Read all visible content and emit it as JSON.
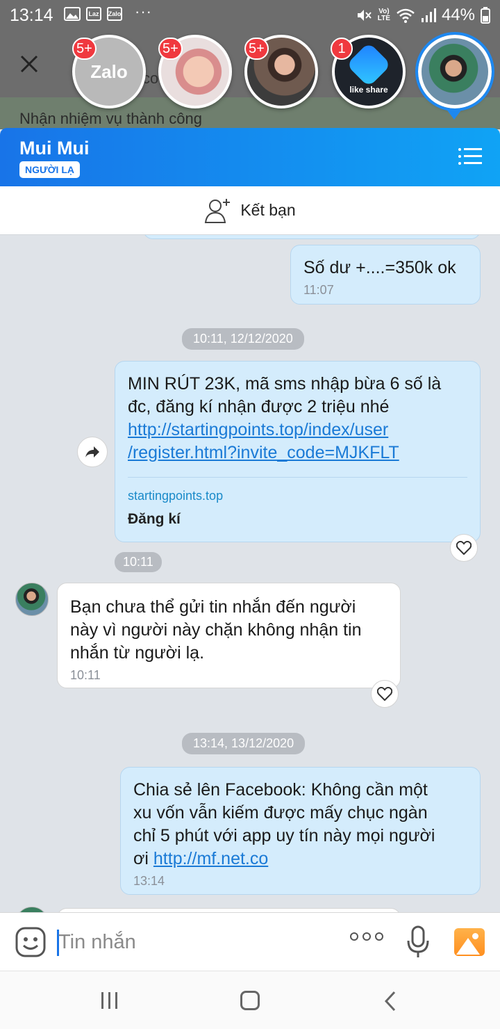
{
  "status_bar": {
    "time": "13:14",
    "app_icons": [
      "gallery-icon",
      "lazada-icon",
      "zalo-icon"
    ],
    "lazada_label": "Laz",
    "zalo_label": "Zalo",
    "more": "···",
    "signal_label_top": "Vo)",
    "signal_label_bottom": "LTE",
    "battery": "44%"
  },
  "background_app": {
    "partial_text": "co",
    "task_text": "Nhận nhiệm vụ thành công"
  },
  "chat_heads": [
    {
      "name": "Zalo",
      "badge": "5+",
      "label": "Zalo"
    },
    {
      "name": "contact-baby",
      "badge": "5+"
    },
    {
      "name": "contact-woman",
      "badge": "5+"
    },
    {
      "name": "Like Share",
      "badge": "1",
      "label": "like share"
    },
    {
      "name": "Mui Mui",
      "badge": "",
      "active": true
    }
  ],
  "chat_header": {
    "title": "Mui Mui",
    "stranger_badge": "NGƯỜI LẠ"
  },
  "friend_bar": {
    "label": "Kết bạn"
  },
  "messages": {
    "msg1": {
      "text": "Số dư +....=350k ok",
      "time": "11:07"
    },
    "date1": "10:11, 12/12/2020",
    "msg2": {
      "text": "MIN RÚT 23K, mã sms nhập bừa 6 số là đc, đăng kí nhận được 2 triệu nhé",
      "link": "http://startingpoints.top/index/user/register.html?invite_code=MJKFLT",
      "link_line1": "http://startingpoints.top/index/user",
      "link_line2": "/register.html?invite_code=MJKFLT",
      "preview_domain": "startingpoints.top",
      "preview_title": "Đăng kí",
      "time": "10:11"
    },
    "msg3": {
      "line1": "Bạn chưa thể gửi tin nhắn đến người",
      "line2": "này vì người này chặn không nhận tin",
      "line3": "nhắn từ người lạ.",
      "time": "10:11"
    },
    "date2": "13:14, 13/12/2020",
    "msg4": {
      "line1": "Chia sẻ lên Facebook: Không cần một",
      "line2": "xu vốn vẫn kiếm được mấy chục ngàn",
      "line3": "chỉ 5 phút với app uy tín này mọi người",
      "line4": "ơi ",
      "link": "http://mf.net.co",
      "time": "13:14"
    }
  },
  "input": {
    "placeholder": "Tin nhắn"
  },
  "colors": {
    "header_gradient_start": "#1874e8",
    "header_gradient_end": "#10a3f5",
    "my_bubble": "#d4ecfc",
    "link": "#1a7ad6",
    "badge": "#f0393f"
  }
}
